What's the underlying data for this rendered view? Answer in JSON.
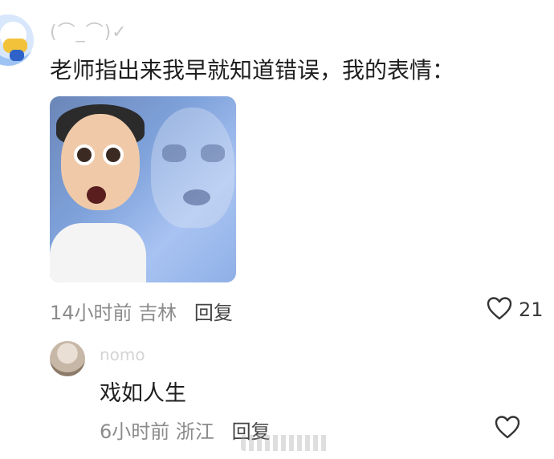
{
  "main_comment": {
    "username": "(⌒_⌒)✓",
    "text": "老师指出来我早就知道错误，我的表情：",
    "time": "14小时前",
    "location": "吉林",
    "reply_label": "回复",
    "like_count": "21"
  },
  "reply_comment": {
    "username": "nomo",
    "text": "戏如人生",
    "time": "6小时前",
    "location": "浙江",
    "reply_label": "回复"
  },
  "icons": {
    "like": "heart-outline-icon"
  }
}
